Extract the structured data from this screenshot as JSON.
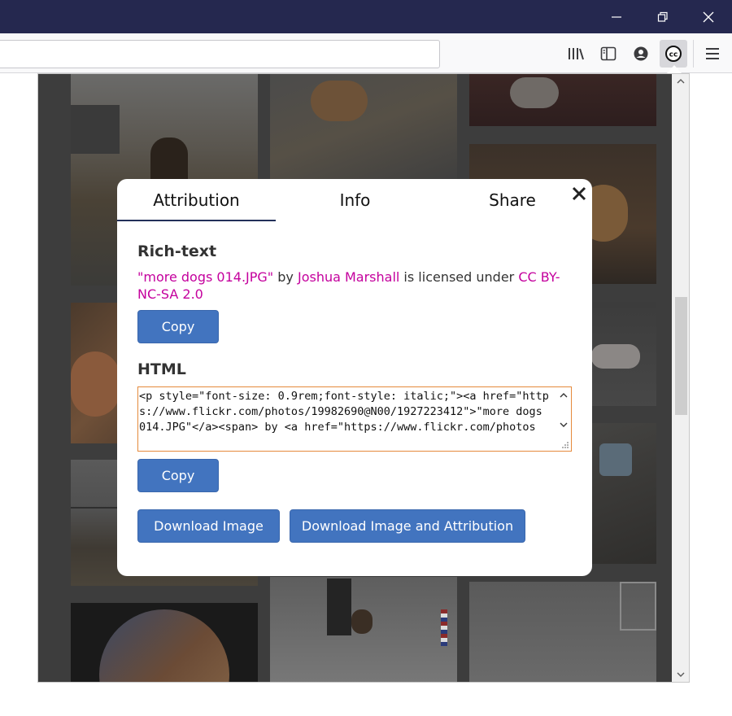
{
  "window": {
    "minimize_icon": "minimize-icon",
    "restore_icon": "restore-icon",
    "close_icon": "close-icon"
  },
  "toolbar": {
    "url_value": "",
    "icons": [
      "library-icon",
      "sidebar-icon",
      "account-icon",
      "creative-commons-icon",
      "hamburger-menu-icon"
    ]
  },
  "modal": {
    "tabs": [
      {
        "label": "Attribution",
        "active": true
      },
      {
        "label": "Info",
        "active": false
      },
      {
        "label": "Share",
        "active": false
      }
    ],
    "rich_text": {
      "title": "Rich-text",
      "work_title": "\"more dogs 014.JPG\"",
      "by": " by ",
      "author": "Joshua Marshall",
      "licensed_under": " is licensed under ",
      "license": "CC BY-NC-SA 2.0",
      "copy_label": "Copy"
    },
    "html": {
      "title": "HTML",
      "code": "<p style=\"font-size: 0.9rem;font-style: italic;\"><a href=\"https://www.flickr.com/photos/19982690@N00/1927223412\">\"more dogs 014.JPG\"</a><span> by <a href=\"https://www.flickr.com/photos",
      "copy_label": "Copy"
    },
    "download_image_label": "Download Image",
    "download_image_attr_label": "Download Image and Attribution"
  },
  "colors": {
    "titlebar": "#25284f",
    "accent_button": "#4274bf",
    "link": "#c4009d",
    "code_border": "#e58a3c",
    "tab_underline": "#23305a"
  }
}
